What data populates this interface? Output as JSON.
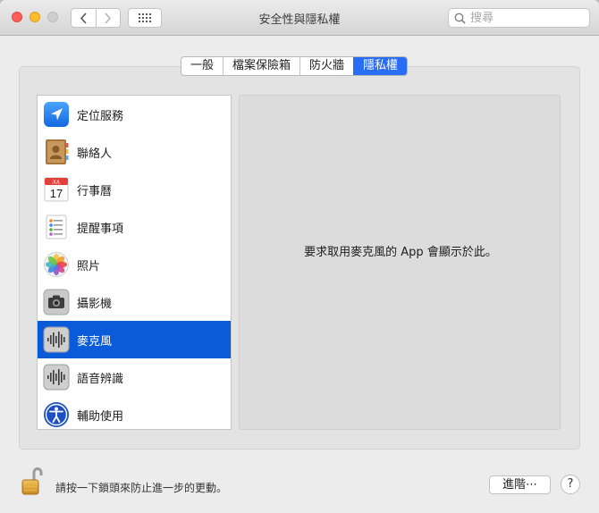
{
  "window": {
    "title": "安全性與隱私權"
  },
  "search": {
    "placeholder": "搜尋"
  },
  "tabs": [
    {
      "label": "一般",
      "active": false
    },
    {
      "label": "檔案保險箱",
      "active": false
    },
    {
      "label": "防火牆",
      "active": false
    },
    {
      "label": "隱私權",
      "active": true
    }
  ],
  "privacy_list": [
    {
      "label": "定位服務",
      "icon": "location-services-icon",
      "selected": false
    },
    {
      "label": "聯絡人",
      "icon": "contacts-icon",
      "selected": false
    },
    {
      "label": "行事曆",
      "icon": "calendar-icon",
      "selected": false,
      "calendar_month": "JUL",
      "calendar_day": "17"
    },
    {
      "label": "提醒事項",
      "icon": "reminders-icon",
      "selected": false
    },
    {
      "label": "照片",
      "icon": "photos-icon",
      "selected": false
    },
    {
      "label": "攝影機",
      "icon": "camera-icon",
      "selected": false
    },
    {
      "label": "麥克風",
      "icon": "microphone-icon",
      "selected": true
    },
    {
      "label": "語音辨識",
      "icon": "speech-recognition-icon",
      "selected": false
    },
    {
      "label": "輔助使用",
      "icon": "accessibility-icon",
      "selected": false
    }
  ],
  "detail": {
    "message": "要求取用麥克風的 App 會顯示於此。"
  },
  "footer": {
    "lock_message": "請按一下鎖頭來防止進一步的更動。",
    "advanced_button": "進階⋯",
    "help_button": "?"
  },
  "colors": {
    "selection": "#0a5bd9",
    "active_tab": "#2a6df5"
  }
}
